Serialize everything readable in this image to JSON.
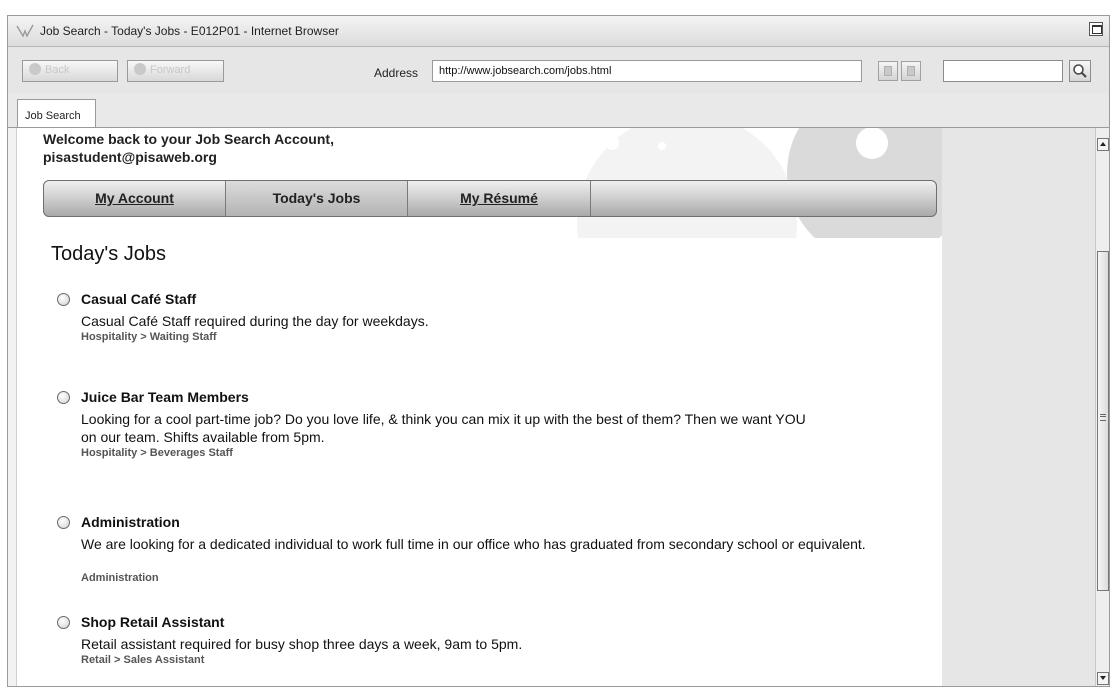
{
  "window": {
    "title": "Job Search - Today's Jobs - E012P01 - Internet Browser"
  },
  "toolbar": {
    "back_label": "Back",
    "forward_label": "Forward",
    "address_label": "Address",
    "address_value": "http://www.jobsearch.com/jobs.html",
    "search_value": ""
  },
  "tabs": [
    {
      "label": "Job Search"
    }
  ],
  "page": {
    "welcome": "Welcome back to your Job Search Account, pisastudent@pisaweb.org",
    "menu": [
      {
        "label": "My Account"
      },
      {
        "label": "Today's Jobs"
      },
      {
        "label": "My Résumé"
      }
    ],
    "title": "Today's Jobs",
    "jobs": [
      {
        "title": "Casual Café Staff",
        "description": "Casual Café Staff required during the day for weekdays.",
        "category": "Hospitality > Waiting Staff"
      },
      {
        "title": "Juice Bar Team Members",
        "description": "Looking for a cool part-time job? Do you love life, & think you can mix it up with the best of them? Then we want YOU on our team. Shifts available from 5pm.",
        "category": "Hospitality > Beverages Staff"
      },
      {
        "title": "Administration",
        "description": "We are looking for a dedicated individual to work full time in our office who has graduated from secondary school or equivalent.",
        "category": "Administration"
      },
      {
        "title": "Shop Retail Assistant",
        "description": "Retail assistant required for busy shop three days a week, 9am to 5pm.",
        "category": "Retail > Sales Assistant"
      }
    ]
  }
}
